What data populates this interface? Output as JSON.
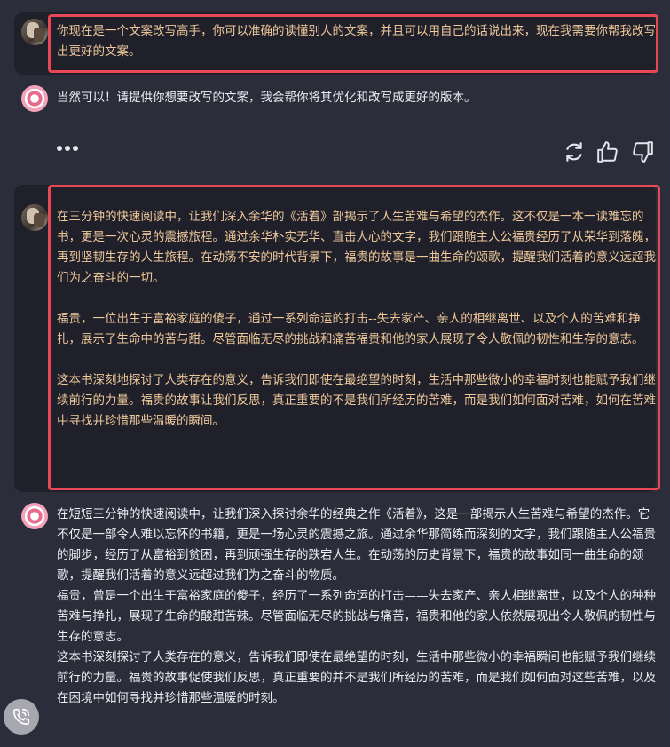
{
  "conversation": [
    {
      "role": "user",
      "text": "你现在是一个文案改写高手，你可以准确的读懂别人的文案，并且可以用自己的话说出来，现在我需要你帮我改写出更好的文案。"
    },
    {
      "role": "assistant",
      "text": "当然可以！请提供你想要改写的文案，我会帮你将其优化和改写成更好的版本。"
    },
    {
      "role": "user",
      "paragraphs": [
        "在三分钟的快速阅读中，让我们深入余华的《活着》部揭示了人生苦难与希望的杰作。这不仅是一本一读难忘的书，更是一次心灵的震撼旅程。通过余华朴实无华、直击人心的文字，我们跟随主人公福贵经历了从荣华到落魄，再到坚韧生存的人生旅程。在动荡不安的时代背景下，福贵的故事是一曲生命的颂歌，提醒我们活着的意义远超我们为之奋斗的一切。",
        "福贵，一位出生于富裕家庭的傻子，通过一系列命运的打击--失去家产、亲人的相继离世、以及个人的苦难和挣扎，展示了生命中的苦与甜。尽管面临无尽的挑战和痛苦福贵和他的家人展现了令人敬佩的韧性和生存的意志。",
        "这本书深刻地探讨了人类存在的意义，告诉我们即使在最绝望的时刻，生活中那些微小的幸福时刻也能赋予我们继续前行的力量。福贵的故事让我们反思，真正重要的不是我们所经历的苦难，而是我们如何面对苦难，如何在苦难中寻找并珍惜那些温暖的瞬间。"
      ]
    },
    {
      "role": "assistant",
      "paragraphs": [
        "在短短三分钟的快速阅读中，让我们深入探讨余华的经典之作《活着》，这是一部揭示人生苦难与希望的杰作。它不仅是一部令人难以忘怀的书籍，更是一场心灵的震撼之旅。通过余华那简练而深刻的文字，我们跟随主人公福贵的脚步，经历了从富裕到贫困，再到顽强生存的跌宕人生。在动荡的历史背景下，福贵的故事如同一曲生命的颂歌，提醒我们活着的意义远超过我们为之奋斗的物质。",
        "福贵，曾是一个出生于富裕家庭的傻子，经历了一系列命运的打击——失去家产、亲人相继离世，以及个人的种种苦难与挣扎，展现了生命的酸甜苦辣。尽管面临无尽的挑战与痛苦，福贵和他的家人依然展现出令人敬佩的韧性与生存的意志。",
        "这本书深刻探讨了人类存在的意义，告诉我们即使在最绝望的时刻，生活中那些微小的幸福瞬间也能赋予我们继续前行的力量。福贵的故事促使我们反思，真正重要的并不是我们所经历的苦难，而是我们如何面对这些苦难，以及在困境中如何寻找并珍惜那些温暖的时刻。"
      ]
    }
  ],
  "actions": {
    "more": "more-dots-icon",
    "regenerate": "refresh-icon",
    "like": "thumbs-up-icon",
    "dislike": "thumbs-down-icon",
    "call": "phone-call-icon"
  },
  "colors": {
    "background": "#2c2d3a",
    "user_bubble": "#1f202a",
    "user_text": "#f0c99a",
    "highlight": "#e84855"
  }
}
